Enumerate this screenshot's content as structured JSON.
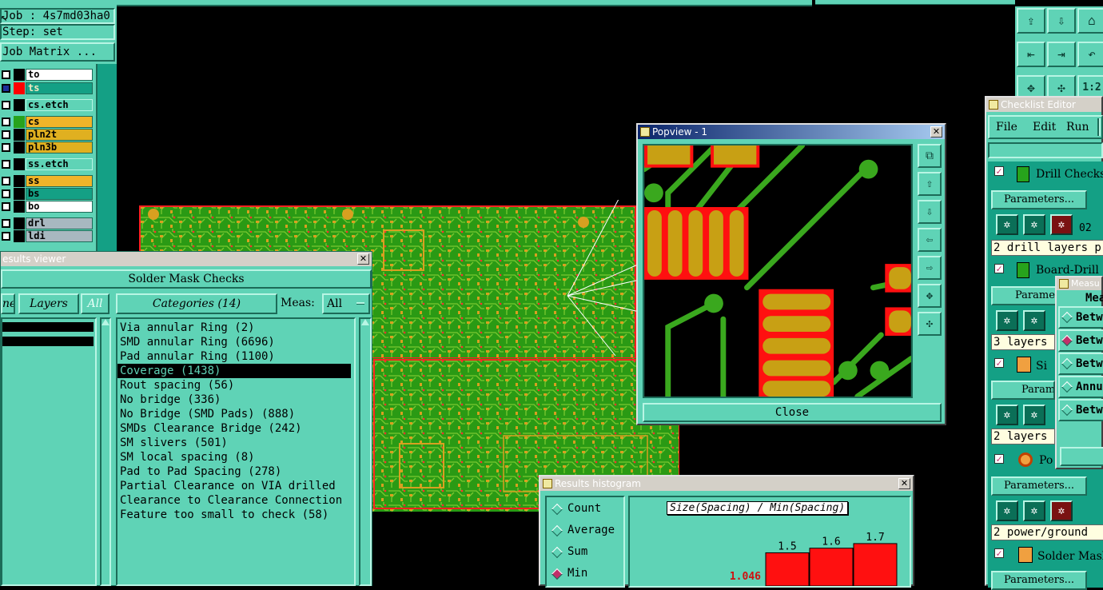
{
  "job": {
    "job_label": "Job : 4s7md03ha0",
    "step_label": "Step: set",
    "matrix_button": "Job Matrix ..."
  },
  "layers": [
    {
      "name": "to",
      "color": "#ffffff",
      "swatch": ""
    },
    {
      "name": "ts",
      "color": "#14a085",
      "swatch": "#ff0000"
    },
    {
      "name": "cs.etch",
      "color": "#5fd3b6",
      "swatch": ""
    },
    {
      "name": "cs",
      "color": "#f0b429",
      "swatch": "#27a31c"
    },
    {
      "name": "pln2t",
      "color": "#e0b020",
      "swatch": ""
    },
    {
      "name": "pln3b",
      "color": "#e0b020",
      "swatch": ""
    },
    {
      "name": "ss.etch",
      "color": "#5fd3b6",
      "swatch": ""
    },
    {
      "name": "ss",
      "color": "#f0b429",
      "swatch": ""
    },
    {
      "name": "bs",
      "color": "#14a085",
      "swatch": ""
    },
    {
      "name": "bo",
      "color": "#ffffff",
      "swatch": ""
    },
    {
      "name": "drl",
      "color": "#a8b8c0",
      "swatch": ""
    },
    {
      "name": "ldi",
      "color": "#a8b8c0",
      "swatch": ""
    }
  ],
  "results_viewer": {
    "title": "esults viewer",
    "close_glyph": "✕",
    "heading": "Solder Mask Checks",
    "tab_prev": "ne",
    "tab_layers": "Layers",
    "tab_all": "All",
    "tab_categories": "Categories (14)",
    "meas_label": "Meas:",
    "meas_value": "All",
    "categories": [
      "Via annular Ring (2)",
      "SMD annular Ring (6696)",
      "Pad annular Ring (1100)",
      "Coverage (1438)",
      "Rout spacing (56)",
      "No bridge (336)",
      "No Bridge (SMD Pads) (888)",
      "SMDs Clearance Bridge (242)",
      "SM slivers (501)",
      "SM local spacing (8)",
      "Pad to Pad Spacing (278)",
      "Partial Clearance on VIA drilled",
      "Clearance to Clearance Connection",
      "Feature too small to check (58)"
    ],
    "selected_index": 3
  },
  "popview": {
    "title": "Popview - 1",
    "close_glyph": "✕",
    "close_button": "Close"
  },
  "histogram": {
    "title": "Results histogram",
    "close_glyph": "✕",
    "options": [
      "Count",
      "Average",
      "Sum",
      "Min"
    ],
    "selected": "Min",
    "chart_title": "Size(Spacing) / Min(Spacing)",
    "chart_data": {
      "type": "bar",
      "title": "Size(Spacing) / Min(Spacing)",
      "data_labels": [
        "1.5",
        "1.6",
        "1.7"
      ],
      "values": [
        1.5,
        1.6,
        1.7
      ],
      "min_label": "1.046",
      "bar_color": "#ff1010"
    }
  },
  "checklist": {
    "title": "Checklist Editor",
    "menu": [
      "File",
      "Edit",
      "Run"
    ],
    "items": [
      {
        "name": "Drill Checks",
        "params": "Parameters...",
        "info": "2 drill layers p",
        "num": "02"
      },
      {
        "name": "Board-Drill",
        "params": "Paramet",
        "info": "3 layers"
      },
      {
        "name": "Si",
        "params": "Paramete",
        "info": "2 layers"
      },
      {
        "name": "Po",
        "params": "Parameters...",
        "info": "2 power/ground"
      },
      {
        "name": "Solder Mask",
        "params": "Parameters..."
      }
    ]
  },
  "measure": {
    "title": "Measu",
    "header": "Mea",
    "options": [
      "Betw",
      "Betw",
      "Betw",
      "Annu",
      "Betw"
    ],
    "selected_index": 1
  },
  "view_toolbar": {
    "zoom_label": "1:2"
  }
}
